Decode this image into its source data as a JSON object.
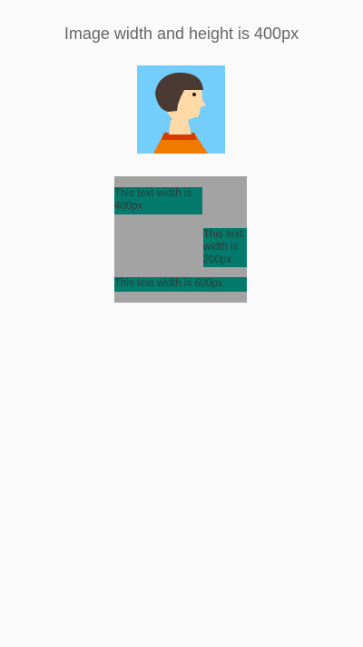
{
  "header": {
    "title": "Image width and height is 400px"
  },
  "avatar": {
    "icon": "person-avatar-icon",
    "colors": {
      "background": "#74cefb",
      "hair": "#4b3a34",
      "skin": "#ffd9a6",
      "shirt": "#f07a00",
      "collar": "#d63b00"
    }
  },
  "texts": {
    "block1": "This text width is 400px",
    "block2": "This text width is 200px",
    "block3": "This text width is 600px"
  },
  "colors": {
    "page_background": "#fafafa",
    "container_background": "#a3a3a3",
    "text_block_background": "#037a6c"
  }
}
